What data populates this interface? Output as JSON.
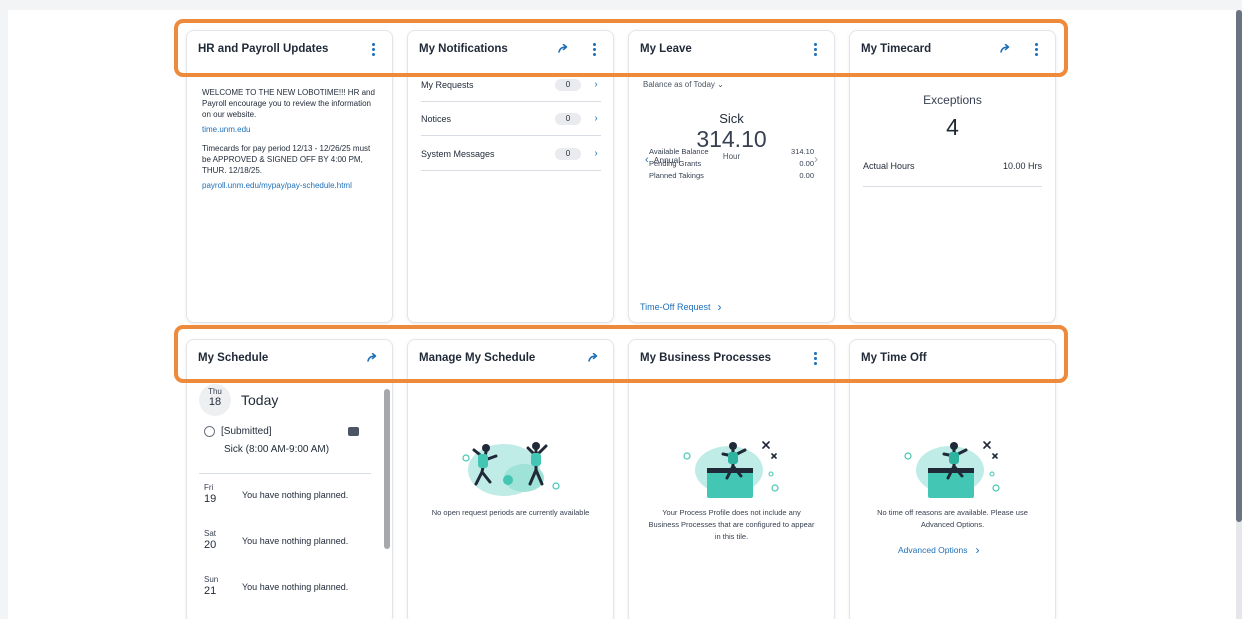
{
  "tiles": {
    "hr": {
      "title": "HR and Payroll Updates",
      "p1": "WELCOME TO THE NEW LOBOTIME!!! HR and Payroll encourage you to review the information on our website.",
      "link1": "time.unm.edu",
      "p2": "Timecards for pay period 12/13 - 12/26/25 must be APPROVED & SIGNED OFF BY 4:00 PM, THUR. 12/18/25.",
      "link2": "payroll.unm.edu/mypay/pay-schedule.html"
    },
    "notifications": {
      "title": "My Notifications",
      "rows": [
        {
          "label": "My Requests",
          "count": "0"
        },
        {
          "label": "Notices",
          "count": "0"
        },
        {
          "label": "System Messages",
          "count": "0"
        }
      ]
    },
    "leave": {
      "title": "My Leave",
      "subtitle": "Balance as of Today",
      "type": "Sick",
      "value": "314.10",
      "unit": "Hour",
      "period": "Annual",
      "rows": [
        {
          "label": "Available Balance",
          "value": "314.10"
        },
        {
          "label": "Pending Grants",
          "value": "0.00"
        },
        {
          "label": "Planned Takings",
          "value": "0.00"
        }
      ],
      "link": "Time-Off Request"
    },
    "timecard": {
      "title": "My Timecard",
      "exceptions_label": "Exceptions",
      "exceptions_value": "4",
      "actual_label": "Actual Hours",
      "actual_value": "10.00 Hrs"
    },
    "schedule": {
      "title": "My Schedule",
      "today": {
        "dow": "Thu",
        "num": "18",
        "label": "Today",
        "status": "[Submitted]",
        "entry": "Sick (8:00 AM-9:00 AM)"
      },
      "days": [
        {
          "dow": "Fri",
          "num": "19",
          "text": "You have nothing planned."
        },
        {
          "dow": "Sat",
          "num": "20",
          "text": "You have nothing planned."
        },
        {
          "dow": "Sun",
          "num": "21",
          "text": "You have nothing planned."
        }
      ]
    },
    "manage_schedule": {
      "title": "Manage My Schedule",
      "empty": "No open request periods are currently available"
    },
    "business_processes": {
      "title": "My Business Processes",
      "empty": "Your Process Profile does not include any Business Processes that are configured to appear in this tile."
    },
    "time_off": {
      "title": "My Time Off",
      "empty": "No time off reasons are available. Please use Advanced Options.",
      "link": "Advanced Options"
    }
  },
  "icons": {
    "go": "arrow-right-icon",
    "more": "kebab-menu-icon",
    "chevron": "chevron-right-icon",
    "dropdown": "chevron-down-icon"
  },
  "colors": {
    "accent": "#1d6fb8",
    "highlight": "#ee8a3c",
    "illustration": "#43c6b4"
  }
}
